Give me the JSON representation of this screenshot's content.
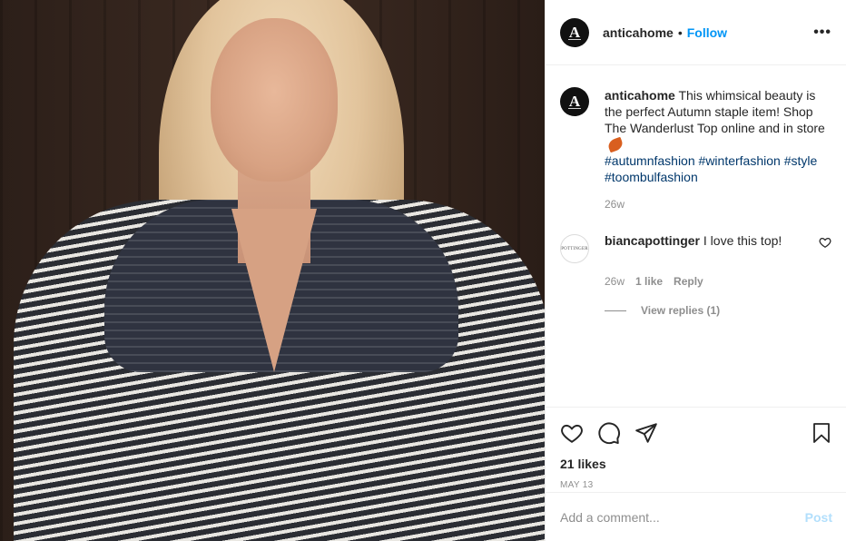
{
  "post": {
    "username": "anticahome",
    "avatar_letter": "A",
    "separator": "•",
    "follow_label": "Follow",
    "more_label": "•••",
    "caption_text": "This whimsical beauty is the perfect Autumn staple item! Shop The Wanderlust Top online and in store",
    "hashtags": [
      "#autumnfashion",
      "#winterfashion",
      "#style",
      "#toombulfashion"
    ],
    "caption_time": "26w"
  },
  "comments": [
    {
      "username": "biancapottinger",
      "avatar_text": "POTTINGER",
      "text": "I love this top!",
      "time": "26w",
      "likes": "1 like",
      "reply_label": "Reply",
      "view_replies": "View replies (1)"
    }
  ],
  "actions": {
    "likes_count": "21 likes",
    "date": "MAY 13"
  },
  "add_comment": {
    "placeholder": "Add a comment...",
    "post_label": "Post"
  },
  "colors": {
    "accent": "#0095f6",
    "hashtag": "#00376b",
    "muted": "#8e8e8e",
    "post_disabled": "#b2dffc"
  }
}
